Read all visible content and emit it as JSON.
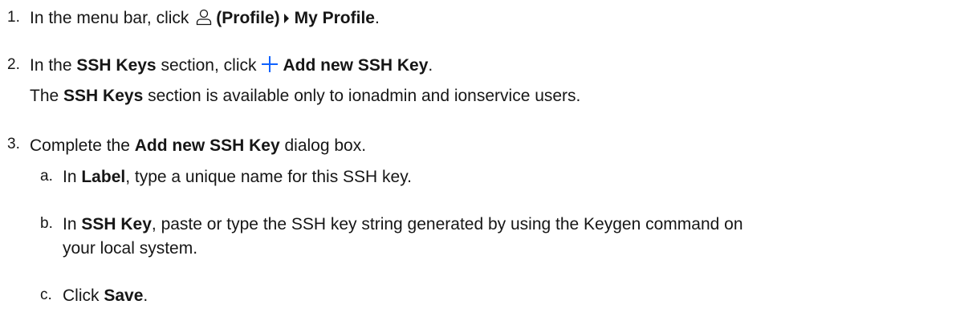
{
  "steps": [
    {
      "number": "1.",
      "t1": "In the menu bar, click",
      "profile": "(Profile)",
      "my_profile": "My Profile",
      "end": "."
    },
    {
      "number": "2.",
      "t1": "In the",
      "ssh_keys": "SSH Keys",
      "t2": "section, click",
      "add_key": "Add new SSH Key",
      "end": ".",
      "note_pre": "The",
      "note_bold": "SSH Keys",
      "note_post": "section is available only to ionadmin and ionservice users."
    },
    {
      "number": "3.",
      "t1": "Complete the",
      "dialog": "Add new SSH Key",
      "t2": "dialog box.",
      "substeps": [
        {
          "letter": "a.",
          "t1": "In",
          "bold": "Label",
          "t2": ", type a unique name for this SSH key."
        },
        {
          "letter": "b.",
          "t1": "In",
          "bold": "SSH Key",
          "t2": ", paste or type the SSH key string generated by using the Keygen command on",
          "t3": "your local system."
        },
        {
          "letter": "c.",
          "t1": "Click",
          "bold": "Save",
          "t2": "."
        }
      ]
    }
  ],
  "icons": {
    "profile": "user-profile-icon",
    "caret": "caret-right-icon",
    "plus": "plus-icon",
    "plus_color": "#0f62fe"
  }
}
